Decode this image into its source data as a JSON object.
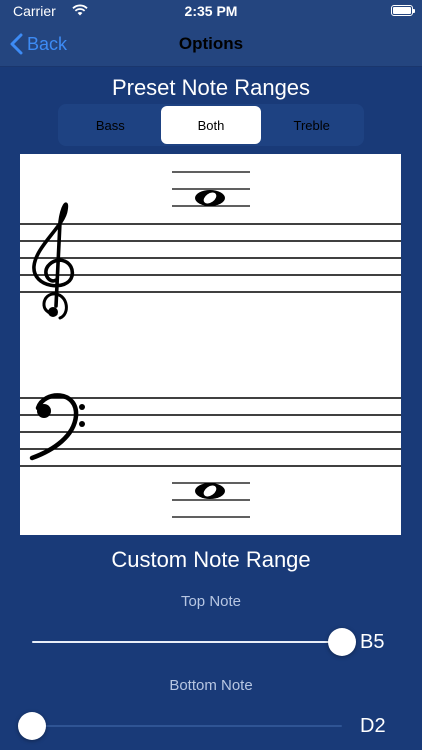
{
  "status": {
    "carrier": "Carrier",
    "time": "2:35 PM"
  },
  "nav": {
    "back_label": "Back",
    "title": "Options"
  },
  "preset": {
    "title": "Preset Note Ranges",
    "segments": [
      "Bass",
      "Both",
      "Treble"
    ],
    "selected": "Both"
  },
  "custom": {
    "title": "Custom Note Range",
    "top_label": "Top Note",
    "top_value": "B5",
    "top_level": 1.0,
    "bottom_label": "Bottom Note",
    "bottom_value": "D2",
    "bottom_level": 0.0
  },
  "colors": {
    "background": "#193a78",
    "bar": "#24457f",
    "accent": "#3d8bf5"
  }
}
